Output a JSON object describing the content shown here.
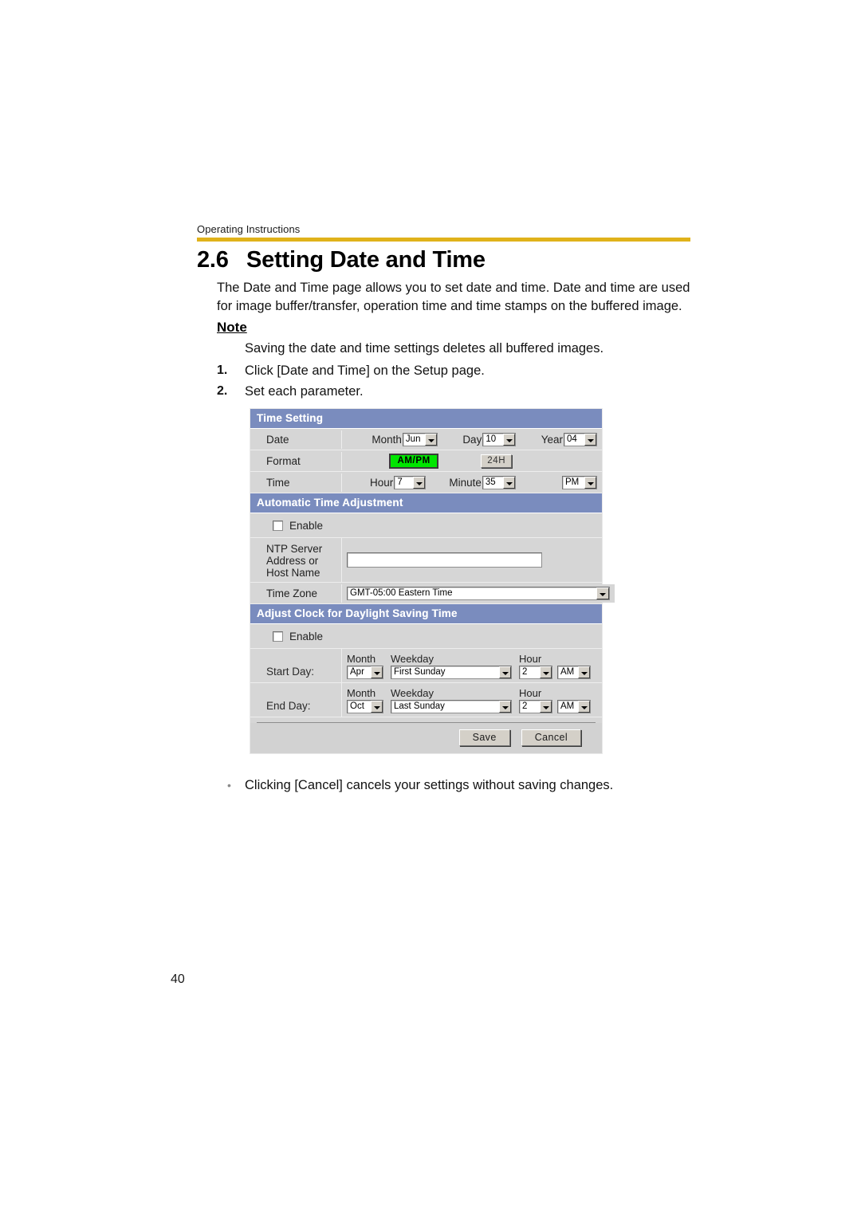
{
  "header": {
    "running_title": "Operating Instructions",
    "rule_color": "#e0b21a"
  },
  "section": {
    "number": "2.6",
    "title": "Setting Date and Time",
    "intro": "The Date and Time page allows you to set date and time. Date and time are used for image buffer/transfer, operation time and time stamps on the buffered image."
  },
  "note": {
    "label": "Note",
    "text": "Saving the date and time settings deletes all buffered images."
  },
  "steps": [
    {
      "marker": "1.",
      "text": "Click [Date and Time] on the Setup page."
    },
    {
      "marker": "2.",
      "text": "Set each parameter."
    }
  ],
  "screenshot": {
    "time_setting": {
      "bar_title": "Time Setting",
      "date": {
        "label": "Date",
        "month_label": "Month",
        "month_value": "Jun",
        "day_label": "Day",
        "day_value": "10",
        "year_label": "Year",
        "year_value": "04"
      },
      "format": {
        "label": "Format",
        "ampm_button": "AM/PM",
        "h24_button": "24H",
        "selected": "AM/PM",
        "selected_color": "#00e500"
      },
      "time": {
        "label": "Time",
        "hour_label": "Hour",
        "hour_value": "7",
        "minute_label": "Minute",
        "minute_value": "35",
        "meridiem_value": "PM"
      }
    },
    "automatic_time_adjustment": {
      "bar_title": "Automatic Time Adjustment",
      "enable_label": "Enable",
      "enable_checked": false,
      "ntp_label": "NTP Server Address or Host Name",
      "ntp_label_lines": [
        "NTP Server",
        "Address or",
        "Host Name"
      ],
      "ntp_value": "",
      "timezone_label": "Time Zone",
      "timezone_value": "GMT-05:00 Eastern Time"
    },
    "daylight_saving": {
      "bar_title": "Adjust Clock for Daylight Saving Time",
      "enable_label": "Enable",
      "enable_checked": false,
      "col_month": "Month",
      "col_weekday": "Weekday",
      "col_hour": "Hour",
      "start": {
        "label": "Start Day:",
        "month": "Apr",
        "weekday": "First Sunday",
        "hour": "2",
        "meridiem": "AM"
      },
      "end": {
        "label": "End Day:",
        "month": "Oct",
        "weekday": "Last Sunday",
        "hour": "2",
        "meridiem": "AM"
      }
    },
    "buttons": {
      "save": "Save",
      "cancel": "Cancel"
    },
    "bar_color": "#7a8cbe"
  },
  "closing": {
    "bullet": "•",
    "text": "Clicking [Cancel] cancels your settings without saving changes."
  },
  "page_number": "40"
}
